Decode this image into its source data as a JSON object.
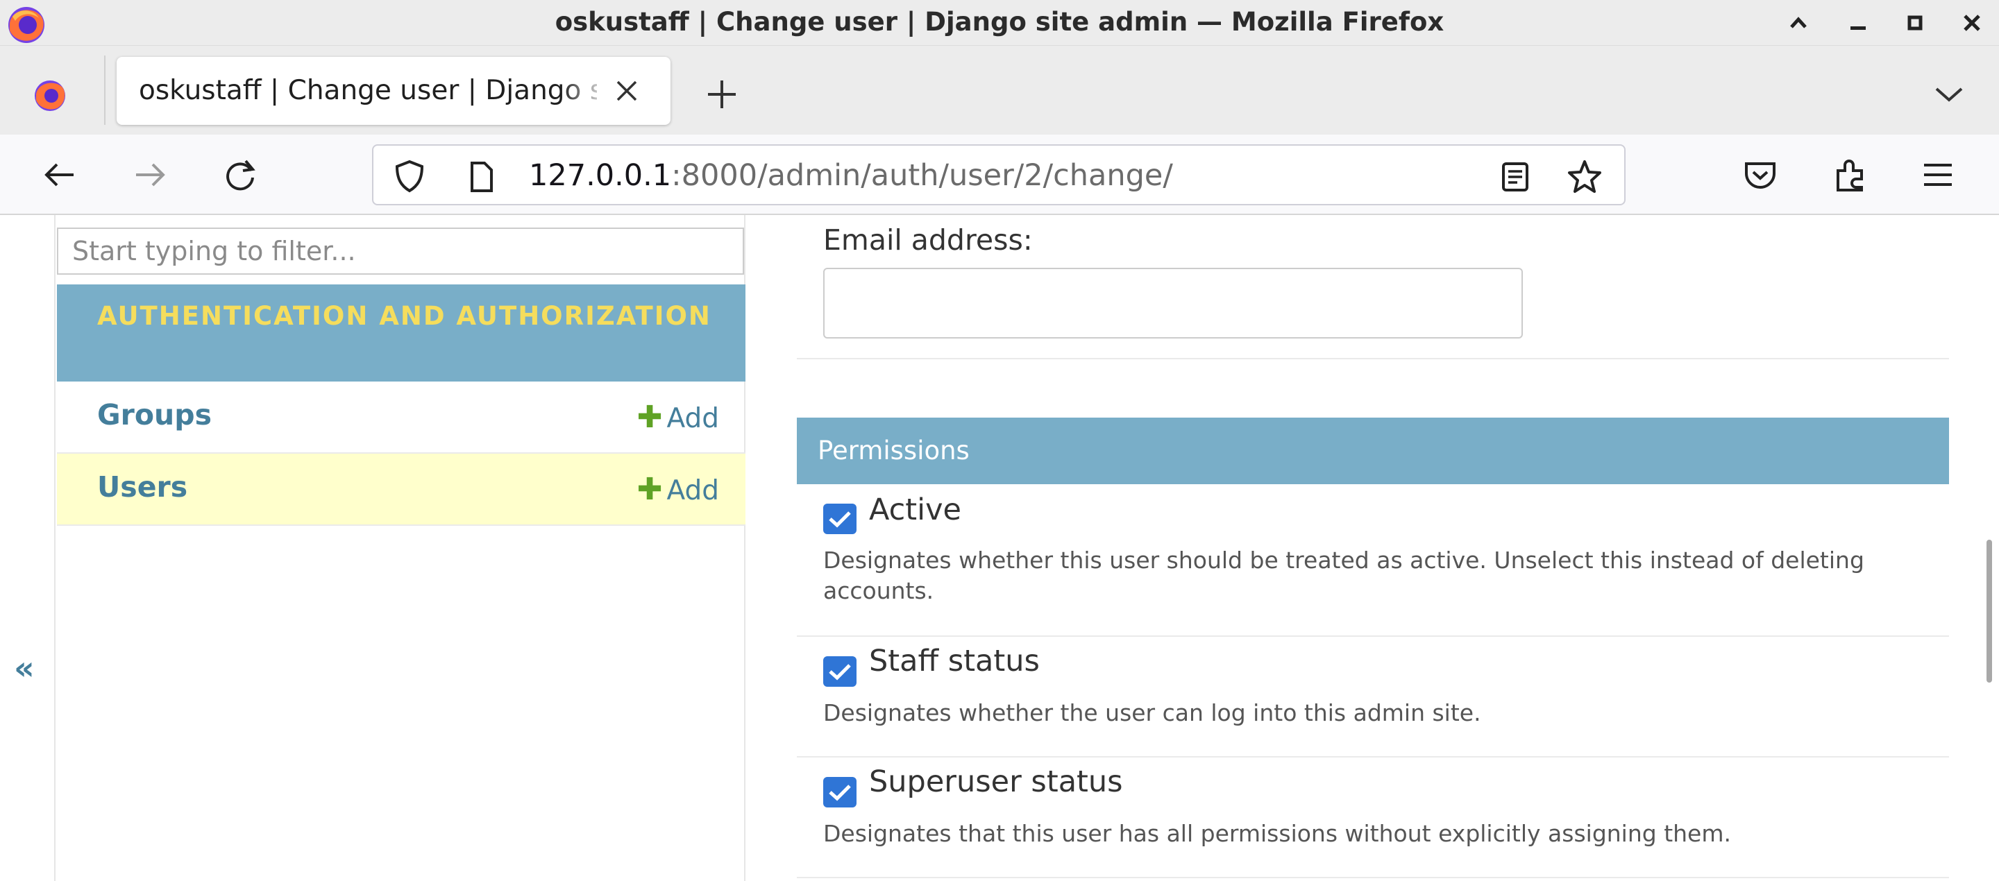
{
  "window": {
    "title": "oskustaff | Change user | Django site admin — Mozilla Firefox"
  },
  "tabs": [
    {
      "title": "oskustaff | Change user | Django site admin"
    }
  ],
  "navbar": {
    "url_host": "127.0.0.1",
    "url_rest": ":8000/admin/auth/user/2/change/"
  },
  "sidebar": {
    "filter_placeholder": "Start typing to filter...",
    "collapse_toggle": "«",
    "app_caption": "AUTHENTICATION AND AUTHORIZATION",
    "models": [
      {
        "name": "Groups",
        "add_label": "Add",
        "current": false
      },
      {
        "name": "Users",
        "add_label": "Add",
        "current": true
      }
    ]
  },
  "form": {
    "email": {
      "label": "Email address:",
      "value": ""
    },
    "permissions": {
      "header": "Permissions",
      "fields": [
        {
          "label": "Active",
          "checked": true,
          "help": "Designates whether this user should be treated as active. Unselect this instead of deleting accounts."
        },
        {
          "label": "Staff status",
          "checked": true,
          "help": "Designates whether the user can log into this admin site."
        },
        {
          "label": "Superuser status",
          "checked": true,
          "help": "Designates that this user has all permissions without explicitly assigning them."
        }
      ]
    }
  },
  "colors": {
    "module_header": "#79aec8",
    "caption_text": "#f5dd5d",
    "link": "#447e9b",
    "add_plus": "#5fa225",
    "checkbox": "#2f75d6",
    "current_row": "#ffffcc"
  },
  "icons": {
    "browser_logo": "firefox-logo-icon",
    "window_controls": [
      "chevron-up-icon",
      "minimize-icon",
      "maximize-icon",
      "close-icon"
    ],
    "tab_close": "close-icon",
    "new_tab": "plus-icon",
    "tab_list": "chevron-down-icon",
    "nav": [
      "back-arrow-icon",
      "forward-arrow-icon",
      "reload-icon"
    ],
    "urlbar": [
      "shield-icon",
      "page-icon",
      "reader-view-icon",
      "bookmark-star-icon"
    ],
    "toolbar": [
      "pocket-icon",
      "extensions-icon",
      "hamburger-menu-icon"
    ]
  }
}
